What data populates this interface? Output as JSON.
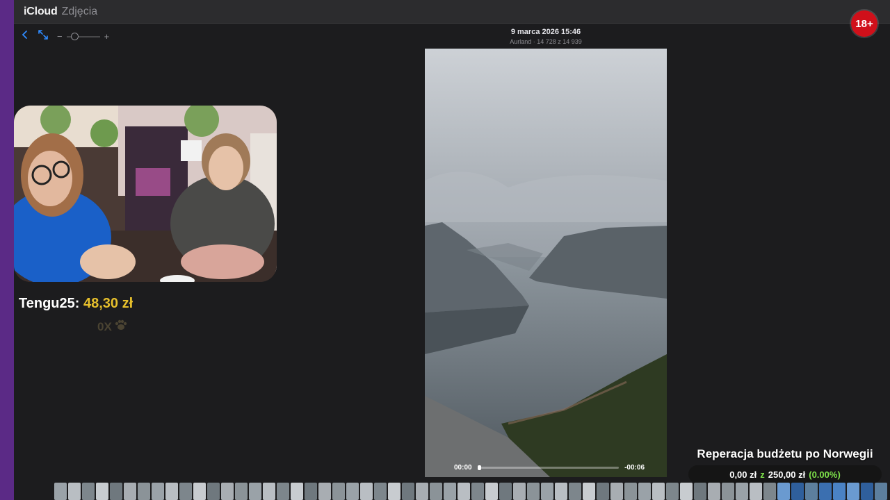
{
  "app": {
    "brand_logo": "apple-logo",
    "brand_name": "iCloud",
    "app_name": "Zdjęcia"
  },
  "toolbar": {
    "back_icon": "chevron-left-icon",
    "fullscreen_icon": "expand-arrows-icon",
    "zoom_out": "−",
    "zoom_in": "+"
  },
  "photo": {
    "date": "9 marca 2026 15:46",
    "subtitle": "Aurland · 14 728 z 14 939",
    "elapsed": "00:00",
    "remaining": "-00:06",
    "progress": 0.0
  },
  "overlay": {
    "age_badge": "18+",
    "donor_name": "Tengu25:",
    "donor_amount": "48,30 zł",
    "paw_count": "0X",
    "paw_icon": "paw-icon"
  },
  "budget": {
    "title": "Reperacja budżetu po Norwegii",
    "current": "0,00 zł",
    "of": "z",
    "goal": "250,00 zł",
    "percent": "(0.00%)"
  },
  "colors": {
    "accent": "#2f8bff",
    "donation_amount": "#e7c02c",
    "goal_green": "#7ee24a",
    "badge_red": "#d0101a"
  }
}
